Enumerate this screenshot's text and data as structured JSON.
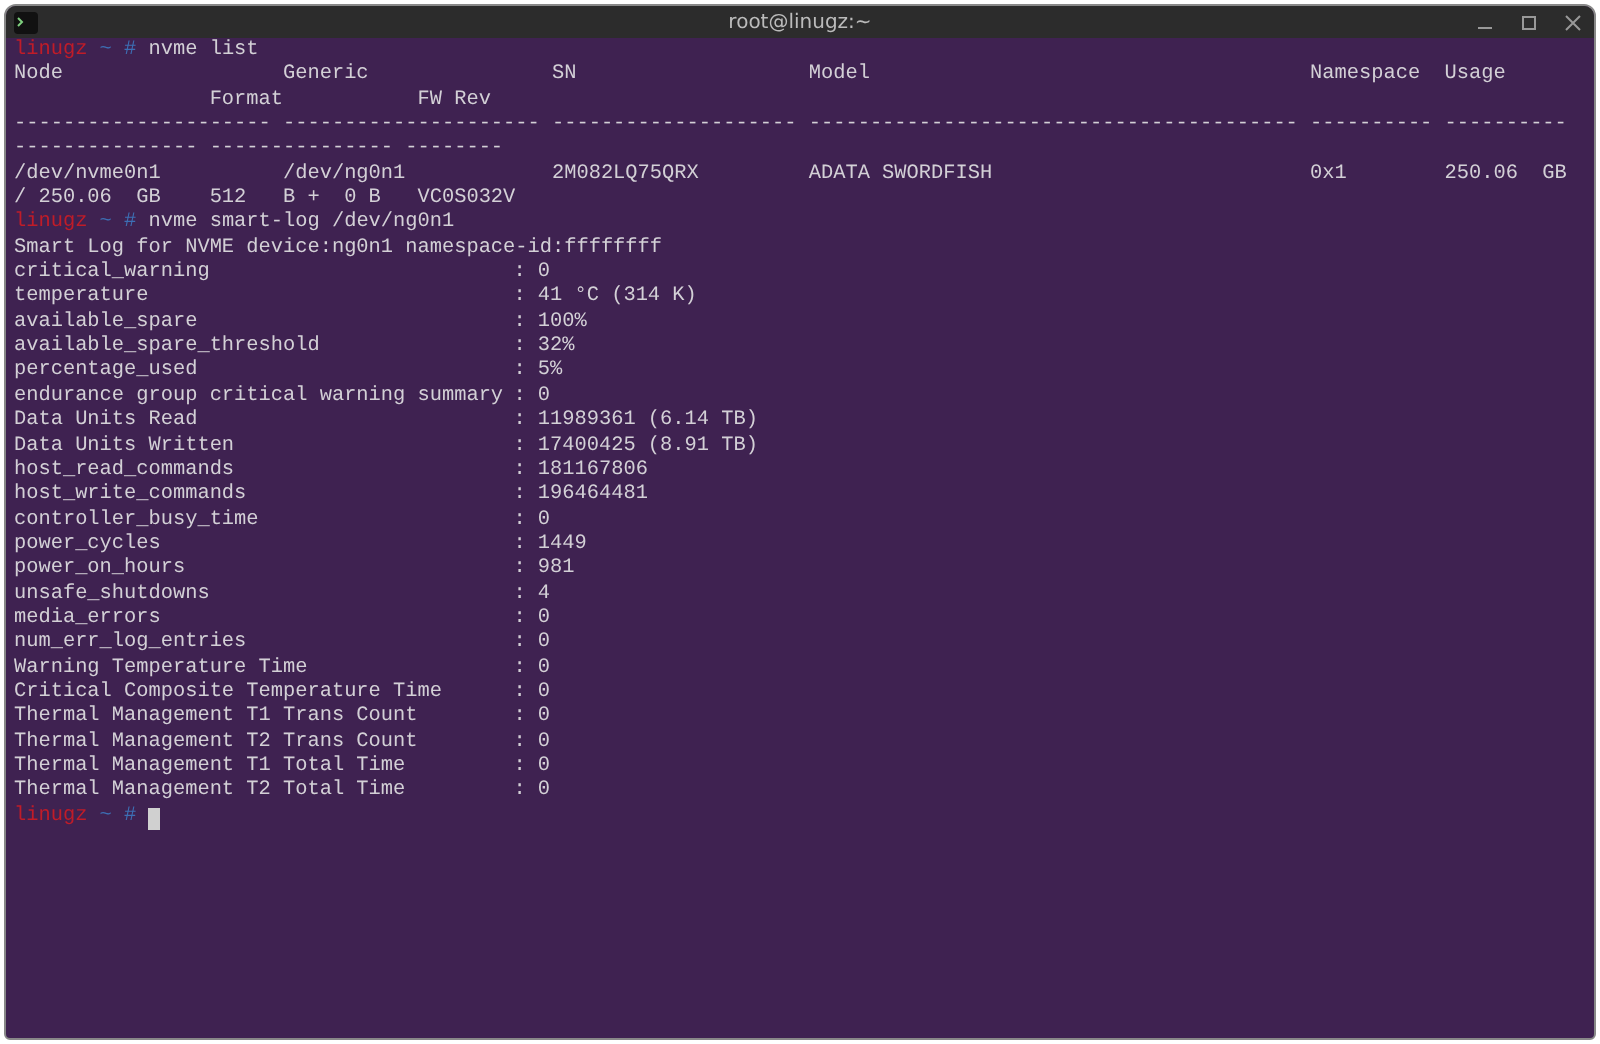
{
  "window": {
    "title": "root@linugz:~"
  },
  "lines": [
    {
      "kind": "prompt",
      "user": "linugz",
      "dir": "~",
      "symbol": "#",
      "command": "nvme list"
    },
    {
      "kind": "output",
      "text": "Node                  Generic               SN                   Model                                    Namespace  Usage"
    },
    {
      "kind": "output",
      "text": "                Format           FW Rev"
    },
    {
      "kind": "output",
      "text": "--------------------- --------------------- -------------------- ---------------------------------------- ---------- ----------"
    },
    {
      "kind": "output",
      "text": "--------------- --------------- --------"
    },
    {
      "kind": "output",
      "text": "/dev/nvme0n1          /dev/ng0n1            2M082LQ75QRX         ADATA SWORDFISH                          0x1        250.06  GB"
    },
    {
      "kind": "output",
      "text": "/ 250.06  GB    512   B +  0 B   VC0S032V"
    },
    {
      "kind": "prompt",
      "user": "linugz",
      "dir": "~",
      "symbol": "#",
      "command": "nvme smart-log /dev/ng0n1"
    },
    {
      "kind": "output",
      "text": "Smart Log for NVME device:ng0n1 namespace-id:ffffffff"
    },
    {
      "kind": "field",
      "key": "critical_warning",
      "value": ": 0"
    },
    {
      "kind": "field",
      "key": "temperature",
      "value": ": 41 °C (314 K)"
    },
    {
      "kind": "field",
      "key": "available_spare",
      "value": ": 100%"
    },
    {
      "kind": "field",
      "key": "available_spare_threshold",
      "value": ": 32%"
    },
    {
      "kind": "field",
      "key": "percentage_used",
      "value": ": 5%"
    },
    {
      "kind": "field",
      "key": "endurance group critical warning summary",
      "value": ": 0"
    },
    {
      "kind": "field",
      "key": "Data Units Read",
      "value": ": 11989361 (6.14 TB)"
    },
    {
      "kind": "field",
      "key": "Data Units Written",
      "value": ": 17400425 (8.91 TB)"
    },
    {
      "kind": "field",
      "key": "host_read_commands",
      "value": ": 181167806"
    },
    {
      "kind": "field",
      "key": "host_write_commands",
      "value": ": 196464481"
    },
    {
      "kind": "field",
      "key": "controller_busy_time",
      "value": ": 0"
    },
    {
      "kind": "field",
      "key": "power_cycles",
      "value": ": 1449"
    },
    {
      "kind": "field",
      "key": "power_on_hours",
      "value": ": 981"
    },
    {
      "kind": "field",
      "key": "unsafe_shutdowns",
      "value": ": 4"
    },
    {
      "kind": "field",
      "key": "media_errors",
      "value": ": 0"
    },
    {
      "kind": "field",
      "key": "num_err_log_entries",
      "value": ": 0"
    },
    {
      "kind": "field",
      "key": "Warning Temperature Time",
      "value": ": 0"
    },
    {
      "kind": "field",
      "key": "Critical Composite Temperature Time",
      "value": ": 0"
    },
    {
      "kind": "field",
      "key": "Thermal Management T1 Trans Count",
      "value": ": 0"
    },
    {
      "kind": "field",
      "key": "Thermal Management T2 Trans Count",
      "value": ": 0"
    },
    {
      "kind": "field",
      "key": "Thermal Management T1 Total Time",
      "value": ": 0"
    },
    {
      "kind": "field",
      "key": "Thermal Management T2 Total Time",
      "value": ": 0"
    },
    {
      "kind": "prompt",
      "user": "linugz",
      "dir": "~",
      "symbol": "#",
      "cursor": true
    }
  ]
}
